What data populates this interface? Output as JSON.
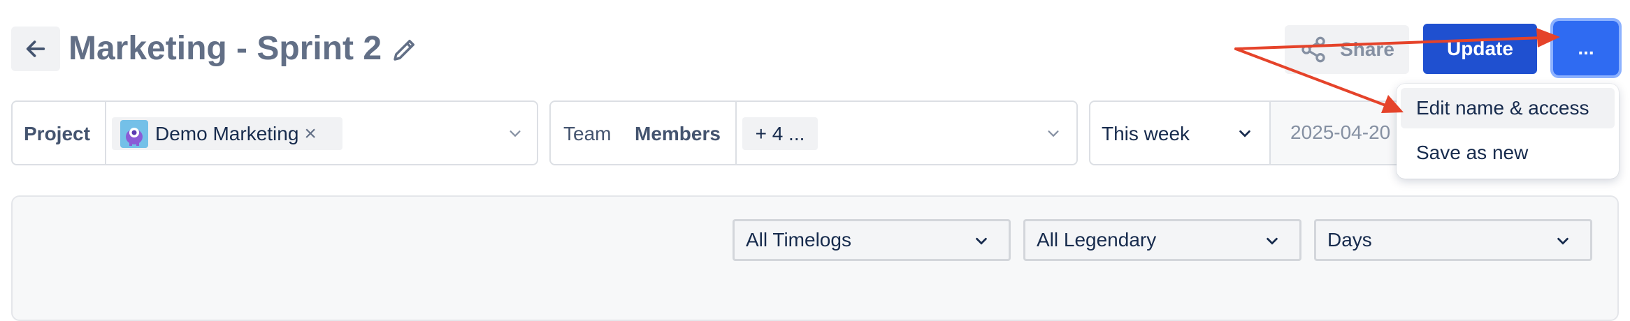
{
  "header": {
    "title": "Marketing - Sprint 2",
    "share_label": "Share",
    "update_label": "Update",
    "more_label": "..."
  },
  "filters": {
    "project": {
      "label": "Project",
      "selected": "Demo Marketing",
      "remove_glyph": "×"
    },
    "team": {
      "team_label": "Team",
      "members_label": "Members",
      "members_chip": "+ 4 ..."
    },
    "date": {
      "range_label": "This week",
      "start_date": "2025-04-20"
    }
  },
  "panel": {
    "timelogs": "All Timelogs",
    "legendary": "All Legendary",
    "granularity": "Days"
  },
  "more_menu": {
    "items": [
      "Edit name & access",
      "Save as new"
    ]
  },
  "colors": {
    "primary": "#1f50d0",
    "annotation_arrow": "#e5432a"
  }
}
